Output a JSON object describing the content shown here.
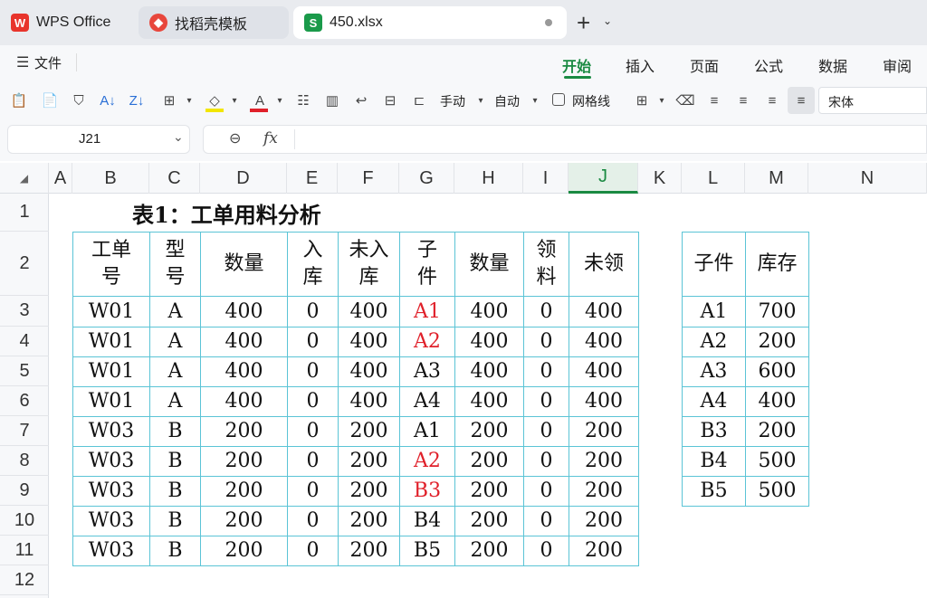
{
  "tabs": [
    {
      "label": "WPS Office",
      "icon": "wps-logo-icon"
    },
    {
      "label": "找稻壳模板",
      "icon": "docer-icon"
    },
    {
      "label": "450.xlsx",
      "icon": "spreadsheet-icon"
    }
  ],
  "new_tab": "+",
  "menu": {
    "file_label": "文件",
    "tabs": [
      "开始",
      "插入",
      "页面",
      "公式",
      "数据",
      "审阅"
    ]
  },
  "toolbar": {
    "manual_label": "手动",
    "auto_label": "自动",
    "gridlines_label": "网格线",
    "font_value": "宋体"
  },
  "formula_bar": {
    "cell_ref": "J21",
    "fx_label": "fx",
    "value": ""
  },
  "columns": [
    "A",
    "B",
    "C",
    "D",
    "E",
    "F",
    "G",
    "H",
    "I",
    "J",
    "K",
    "L",
    "M",
    "N"
  ],
  "rows": [
    "1",
    "2",
    "3",
    "4",
    "5",
    "6",
    "7",
    "8",
    "9",
    "10",
    "11",
    "12"
  ],
  "sheet": {
    "title": "表1：工单用料分析",
    "main_headers": [
      "工单\n号",
      "型\n号",
      "数量",
      "入\n库",
      "未入\n库",
      "子\n件",
      "数量",
      "领\n料",
      "未领"
    ],
    "main_rows": [
      [
        "W01",
        "A",
        "400",
        "0",
        "400",
        "A1",
        "400",
        "0",
        "400"
      ],
      [
        "W01",
        "A",
        "400",
        "0",
        "400",
        "A2",
        "400",
        "0",
        "400"
      ],
      [
        "W01",
        "A",
        "400",
        "0",
        "400",
        "A3",
        "400",
        "0",
        "400"
      ],
      [
        "W01",
        "A",
        "400",
        "0",
        "400",
        "A4",
        "400",
        "0",
        "400"
      ],
      [
        "W03",
        "B",
        "200",
        "0",
        "200",
        "A1",
        "200",
        "0",
        "200"
      ],
      [
        "W03",
        "B",
        "200",
        "0",
        "200",
        "A2",
        "200",
        "0",
        "200"
      ],
      [
        "W03",
        "B",
        "200",
        "0",
        "200",
        "B3",
        "200",
        "0",
        "200"
      ],
      [
        "W03",
        "B",
        "200",
        "0",
        "200",
        "B4",
        "200",
        "0",
        "200"
      ],
      [
        "W03",
        "B",
        "200",
        "0",
        "200",
        "B5",
        "200",
        "0",
        "200"
      ]
    ],
    "red_part_rows": [
      0,
      1,
      5,
      6
    ],
    "stock_headers": [
      "子件",
      "库存"
    ],
    "stock_rows": [
      [
        "A1",
        "700"
      ],
      [
        "A2",
        "200"
      ],
      [
        "A3",
        "600"
      ],
      [
        "A4",
        "400"
      ],
      [
        "B3",
        "200"
      ],
      [
        "B4",
        "500"
      ],
      [
        "B5",
        "500"
      ]
    ]
  },
  "colors": {
    "accent_green": "#1a8a42",
    "table_border": "#5bc4d6",
    "highlight_red": "#e0202a"
  }
}
